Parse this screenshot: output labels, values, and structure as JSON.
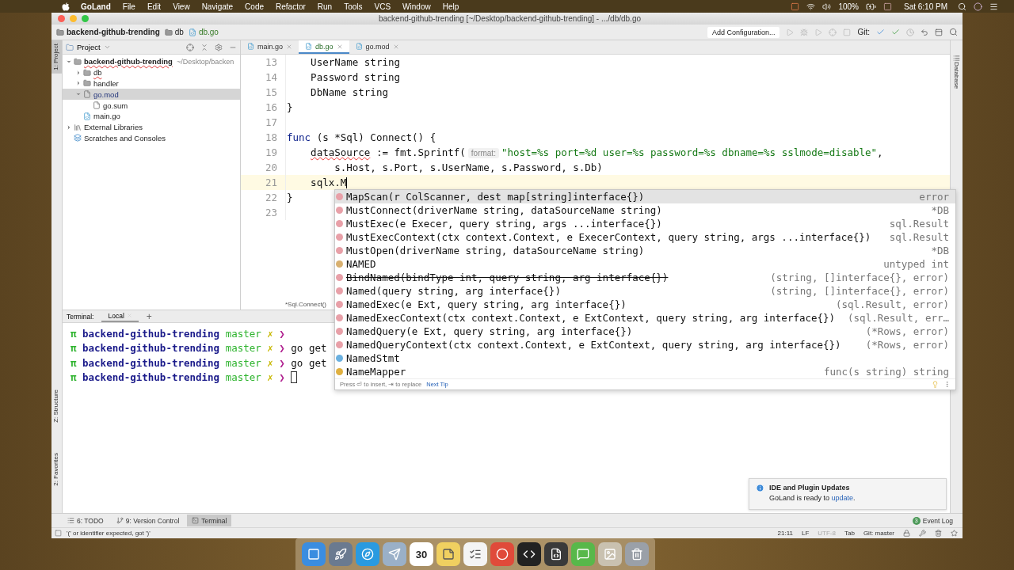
{
  "menu_bar": {
    "app": "GoLand",
    "items": [
      "File",
      "Edit",
      "View",
      "Navigate",
      "Code",
      "Refactor",
      "Run",
      "Tools",
      "VCS",
      "Window",
      "Help"
    ],
    "battery": "100%",
    "clock": "Sat 6:10 PM"
  },
  "window": {
    "title": "backend-github-trending [~/Desktop/backend-github-trending] - .../db/db.go"
  },
  "navigation_bar": {
    "breadcrumbs": [
      {
        "label": "backend-github-trending",
        "kind": "project"
      },
      {
        "label": "db",
        "kind": "folder"
      },
      {
        "label": "db.go",
        "kind": "file"
      }
    ],
    "run_configuration": "Add Configuration...",
    "git_label": "Git:"
  },
  "left_tool_strip": [
    {
      "label": "1: Project",
      "selected": true,
      "kind": "top"
    },
    {
      "label": "Z: Structure",
      "selected": false,
      "kind": "bottom"
    },
    {
      "label": "2: Favorites",
      "selected": false,
      "kind": "bottom"
    }
  ],
  "right_tool_strip": [
    {
      "label": "Database"
    }
  ],
  "project_panel": {
    "title": "Project",
    "tree": [
      {
        "label": "backend-github-trending",
        "path": "~/Desktop/backen",
        "kind": "project",
        "expanded": true,
        "selected": false,
        "error": true,
        "children": [
          {
            "label": "db",
            "kind": "folder",
            "expanded": false,
            "selected": false,
            "error": true
          },
          {
            "label": "handler",
            "kind": "folder",
            "expanded": false,
            "selected": false,
            "error": false
          },
          {
            "label": "go.mod",
            "kind": "file",
            "expanded": true,
            "selected": true,
            "error": false,
            "children": [
              {
                "label": "go.sum",
                "kind": "file",
                "selected": false,
                "error": false
              }
            ]
          },
          {
            "label": "main.go",
            "kind": "gofile",
            "selected": false,
            "error": false
          }
        ]
      },
      {
        "label": "External Libraries",
        "kind": "libraries",
        "expanded": false,
        "selected": false,
        "error": false
      },
      {
        "label": "Scratches and Consoles",
        "kind": "scratches",
        "selected": false,
        "error": false
      }
    ]
  },
  "editor": {
    "tabs": [
      {
        "label": "main.go",
        "selected": false
      },
      {
        "label": "db.go",
        "selected": true
      },
      {
        "label": "go.mod",
        "selected": false
      }
    ],
    "lines": [
      {
        "number": "13",
        "current": false,
        "tokens": [
          {
            "text": "    UserName string",
            "kind": "plain"
          }
        ]
      },
      {
        "number": "14",
        "current": false,
        "tokens": [
          {
            "text": "    Password string",
            "kind": "plain"
          }
        ]
      },
      {
        "number": "15",
        "current": false,
        "tokens": [
          {
            "text": "    DbName string",
            "kind": "plain"
          }
        ]
      },
      {
        "number": "16",
        "current": false,
        "tokens": [
          {
            "text": "}",
            "kind": "plain"
          }
        ]
      },
      {
        "number": "17",
        "current": false
      },
      {
        "number": "18",
        "current": false,
        "tokens": [
          {
            "text": "func",
            "kind": "keyword"
          },
          {
            "text": " (s *Sql) Connect() {",
            "kind": "plain"
          }
        ]
      },
      {
        "number": "19",
        "current": false,
        "tokens": [
          {
            "text": "    dataSource",
            "kind": "error"
          },
          {
            "text": " := fmt.Sprintf(",
            "kind": "plain"
          },
          {
            "text": "format:",
            "kind": "hint"
          },
          {
            "text": "\"host=%s port=%d user=%s password=%s dbname=%s sslmode=disable\"",
            "kind": "string"
          },
          {
            "text": ",",
            "kind": "plain"
          }
        ]
      },
      {
        "number": "20",
        "current": false,
        "tokens": [
          {
            "text": "        s.Host, s.Port, s.UserName, s.Password, s.Db)",
            "kind": "plain"
          }
        ]
      },
      {
        "number": "21",
        "current": true,
        "tokens": [
          {
            "text": "    sqlx.M",
            "kind": "plain"
          }
        ]
      },
      {
        "number": "22",
        "current": false,
        "tokens": [
          {
            "text": "}",
            "kind": "plain"
          }
        ]
      },
      {
        "number": "23",
        "current": false
      }
    ],
    "breadcrumb": "*Sql.Connect()"
  },
  "completion": {
    "items": [
      {
        "kind": "function",
        "name": "MapScan(r ColScanner, dest map[string]interface{})",
        "type": "error",
        "selected": true,
        "deprecated": false
      },
      {
        "kind": "function",
        "name": "MustConnect(driverName string, dataSourceName string)",
        "type": "*DB",
        "selected": false,
        "deprecated": false
      },
      {
        "kind": "function",
        "name": "MustExec(e Execer, query string, args ...interface{})",
        "type": "sql.Result",
        "selected": false,
        "deprecated": false
      },
      {
        "kind": "function",
        "name": "MustExecContext(ctx context.Context, e ExecerContext, query string, args ...interface{})",
        "type": "sql.Result",
        "selected": false,
        "deprecated": false
      },
      {
        "kind": "function",
        "name": "MustOpen(driverName string, dataSourceName string)",
        "type": "*DB",
        "selected": false,
        "deprecated": false
      },
      {
        "kind": "constant",
        "name": "NAMED",
        "type": "untyped int",
        "selected": false,
        "deprecated": false
      },
      {
        "kind": "function",
        "name": "BindNamed(bindType int, query string, arg interface{})",
        "type": "(string, []interface{}, error)",
        "selected": false,
        "deprecated": true
      },
      {
        "kind": "function",
        "name": "Named(query string, arg interface{})",
        "type": "(string, []interface{}, error)",
        "selected": false,
        "deprecated": false
      },
      {
        "kind": "function",
        "name": "NamedExec(e Ext, query string, arg interface{})",
        "type": "(sql.Result, error)",
        "selected": false,
        "deprecated": false
      },
      {
        "kind": "function",
        "name": "NamedExecContext(ctx context.Context, e ExtContext, query string, arg interface{})",
        "type": "(sql.Result, err…",
        "selected": false,
        "deprecated": false
      },
      {
        "kind": "function",
        "name": "NamedQuery(e Ext, query string, arg interface{})",
        "type": "(*Rows, error)",
        "selected": false,
        "deprecated": false
      },
      {
        "kind": "function",
        "name": "NamedQueryContext(ctx context.Context, e ExtContext, query string, arg interface{})",
        "type": "(*Rows, error)",
        "selected": false,
        "deprecated": false
      },
      {
        "kind": "type",
        "name": "NamedStmt",
        "selected": false,
        "deprecated": false
      },
      {
        "kind": "variable",
        "name": "NameMapper",
        "type": "func(s string) string",
        "selected": false,
        "deprecated": false
      }
    ],
    "footer": "Press ⏎ to insert, ⇥ to replace",
    "tip_link": "Next Tip"
  },
  "terminal": {
    "label": "Terminal:",
    "tabs": [
      {
        "label": "Local",
        "selected": true
      }
    ],
    "add": "+",
    "lines": [
      {
        "prompt": "π",
        "dir": "backend-github-trending",
        "branch": "master",
        "dirty": "✗",
        "arrow": "❯",
        "cursor": false
      },
      {
        "prompt": "π",
        "dir": "backend-github-trending",
        "branch": "master",
        "dirty": "✗",
        "arrow": "❯",
        "command": "go get",
        "cursor": false
      },
      {
        "prompt": "π",
        "dir": "backend-github-trending",
        "branch": "master",
        "dirty": "✗",
        "arrow": "❯",
        "command": "go get",
        "cursor": false
      },
      {
        "prompt": "π",
        "dir": "backend-github-trending",
        "branch": "master",
        "dirty": "✗",
        "arrow": "❯",
        "cursor": true
      }
    ]
  },
  "notification": {
    "title": "IDE and Plugin Updates",
    "text": "GoLand is ready to ",
    "link": "update",
    "end": "."
  },
  "tool_tabs": [
    {
      "label": "6: TODO",
      "kind": "todo",
      "selected": false
    },
    {
      "label": "9: Version Control",
      "kind": "vcs",
      "selected": false
    },
    {
      "label": "Terminal",
      "kind": "terminal",
      "selected": true
    }
  ],
  "event_log": {
    "label": "Event Log",
    "count": "3"
  },
  "status_bar": {
    "message": "'(' or identifier expected, got ')'",
    "items": [
      {
        "text": "21:11",
        "disabled": false
      },
      {
        "text": "LF",
        "disabled": false
      },
      {
        "text": "UTF-8",
        "disabled": true
      },
      {
        "text": "Tab",
        "disabled": false
      },
      {
        "text": "Git: master",
        "disabled": false
      }
    ]
  },
  "dock": [
    {
      "kind": "finder"
    },
    {
      "kind": "launchpad"
    },
    {
      "kind": "safari"
    },
    {
      "kind": "mail"
    },
    {
      "kind": "calendar",
      "label": "30"
    },
    {
      "kind": "notes"
    },
    {
      "kind": "reminders"
    },
    {
      "kind": "chrome"
    },
    {
      "kind": "goland"
    },
    {
      "kind": "sublime"
    },
    {
      "kind": "app"
    },
    {
      "kind": "preview"
    },
    {
      "kind": "trash"
    }
  ]
}
